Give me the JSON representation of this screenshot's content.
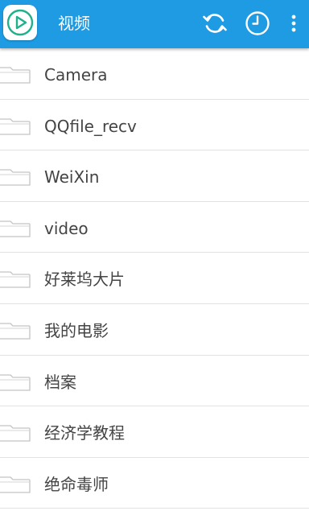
{
  "header": {
    "title": "视频",
    "colors": {
      "bar": "#1e9be3",
      "text": "#ffffff"
    },
    "actions": [
      {
        "icon": "refresh-icon"
      },
      {
        "icon": "history-clock-icon"
      },
      {
        "icon": "more-vert-icon"
      }
    ]
  },
  "folders": [
    {
      "label": "Camera",
      "icon": "folder-icon"
    },
    {
      "label": "QQfile_recv",
      "icon": "folder-icon"
    },
    {
      "label": "WeiXin",
      "icon": "folder-icon"
    },
    {
      "label": "video",
      "icon": "folder-icon"
    },
    {
      "label": "好莱坞大片",
      "icon": "folder-icon"
    },
    {
      "label": "我的电影",
      "icon": "folder-icon"
    },
    {
      "label": "档案",
      "icon": "folder-icon"
    },
    {
      "label": "经济学教程",
      "icon": "folder-icon"
    },
    {
      "label": "绝命毒师",
      "icon": "folder-icon"
    }
  ]
}
